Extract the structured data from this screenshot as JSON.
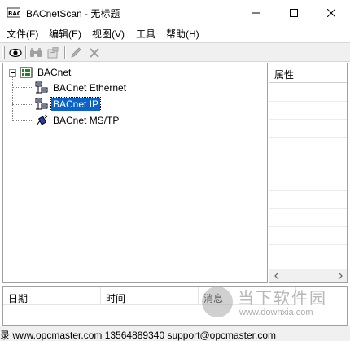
{
  "window": {
    "title": "BACnetScan - 无标题",
    "app_icon": "bacnet-app-icon"
  },
  "menu": [
    {
      "label": "文件(F)"
    },
    {
      "label": "编辑(E)"
    },
    {
      "label": "视图(V)"
    },
    {
      "label": "工具"
    },
    {
      "label": "帮助(H)"
    }
  ],
  "toolbar": {
    "buttons": [
      "eye-icon",
      "binoculars-icon",
      "properties-icon",
      "pencil-icon",
      "delete-icon"
    ]
  },
  "tree": {
    "root": {
      "label": "BACnet",
      "icon": "network-grid-icon",
      "expanded": true
    },
    "children": [
      {
        "label": "BACnet Ethernet",
        "icon": "network-computers-icon",
        "selected": false
      },
      {
        "label": "BACnet IP",
        "icon": "network-computers-icon",
        "selected": true
      },
      {
        "label": "BACnet MS/TP",
        "icon": "serial-plug-icon",
        "selected": false
      }
    ]
  },
  "properties": {
    "header": "属性"
  },
  "log": {
    "columns": [
      "日期",
      "时间",
      "消息"
    ]
  },
  "status": {
    "text": "录 www.opcmaster.com 13564889340 support@opcmaster.com"
  },
  "watermark": {
    "brand": "当下软件园",
    "url": "www.downxia.com"
  },
  "colors": {
    "selection": "#0a64c8",
    "chrome": "#f0f0f0"
  }
}
